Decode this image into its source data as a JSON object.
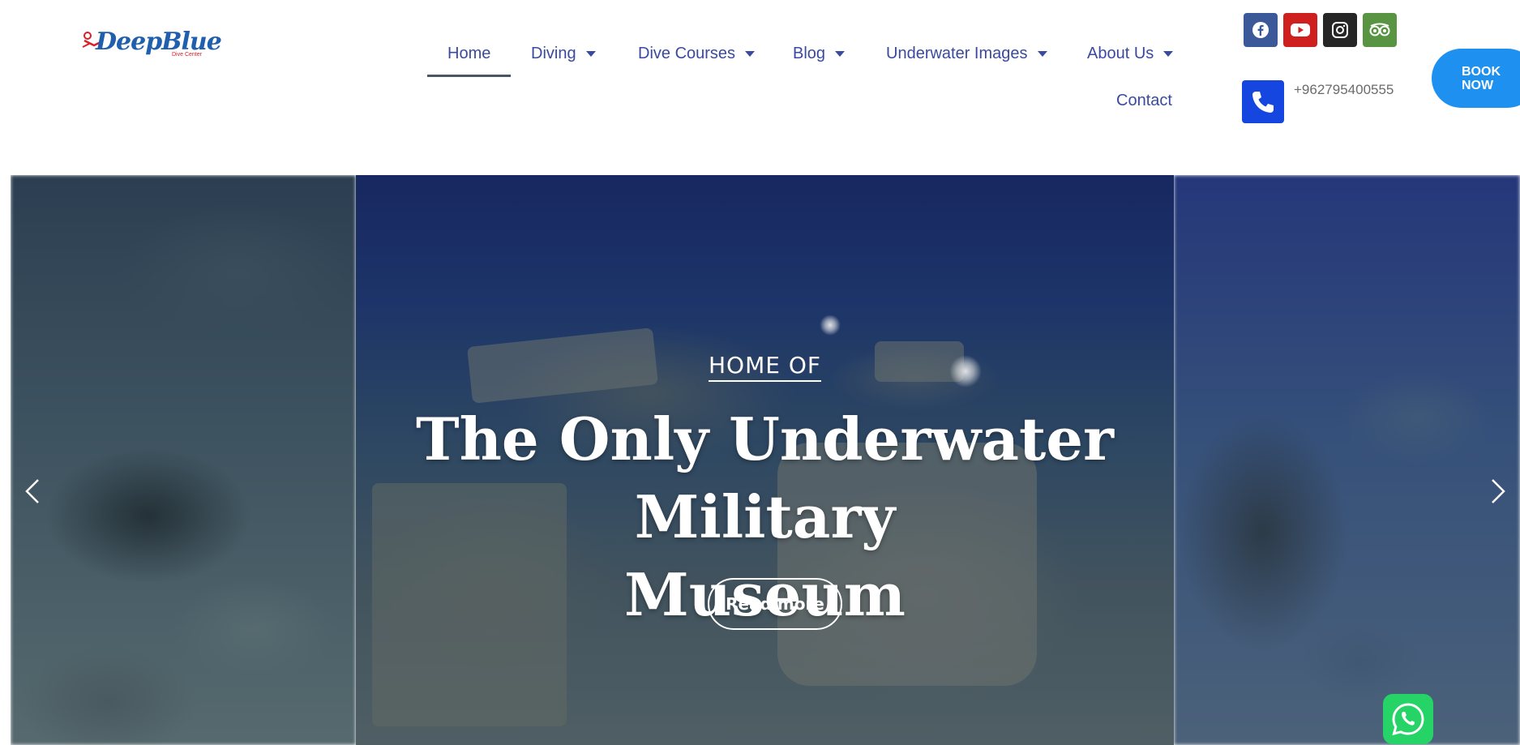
{
  "logo": {
    "text": "DeepBlue",
    "subtext": "Dive Center"
  },
  "nav": {
    "home": "Home",
    "diving": "Diving",
    "dive_courses": "Dive Courses",
    "blog": "Blog",
    "underwater_images": "Underwater Images",
    "about_us": "About Us",
    "contact": "Contact",
    "active": "Home"
  },
  "social": [
    {
      "name": "facebook-icon",
      "color": "#3b5998"
    },
    {
      "name": "youtube-icon",
      "color": "#cd201f"
    },
    {
      "name": "instagram-icon",
      "color": "#262626"
    },
    {
      "name": "tripadvisor-icon",
      "color": "#589442"
    }
  ],
  "contact": {
    "phone": "+962795400555"
  },
  "cta": {
    "line1": "BOOK",
    "line2": "NOW"
  },
  "hero": {
    "kicker": "HOME OF",
    "title_line1": "The Only Underwater Military",
    "title_line2": "Museum",
    "button": "Read more"
  },
  "colors": {
    "nav_text": "#3a4a9f",
    "book_button": "#1e90f0",
    "phone_box": "#1547e0",
    "whatsapp": "#25d366"
  }
}
